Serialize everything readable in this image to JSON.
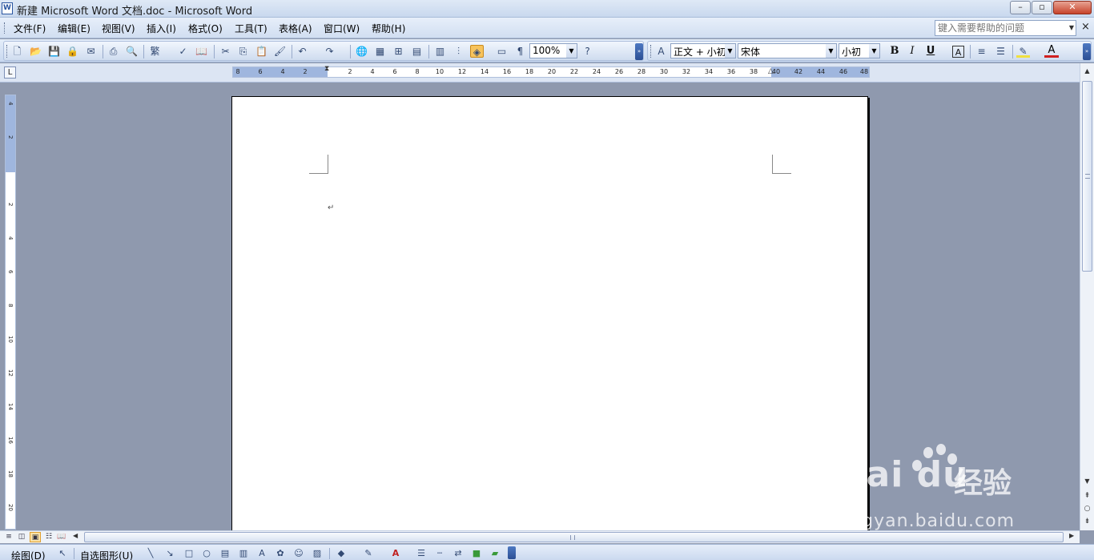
{
  "window": {
    "title": "新建 Microsoft Word 文档.doc - Microsoft Word",
    "app_icon": "W",
    "minimize_glyph": "–",
    "maximize_glyph": "▫",
    "close_glyph": "✕"
  },
  "menubar": {
    "items": [
      "文件(F)",
      "编辑(E)",
      "视图(V)",
      "插入(I)",
      "格式(O)",
      "工具(T)",
      "表格(A)",
      "窗口(W)",
      "帮助(H)"
    ],
    "help_placeholder": "键入需要帮助的问题",
    "close_doc_glyph": "×"
  },
  "standard_toolbar": {
    "zoom": "100%"
  },
  "format_toolbar": {
    "style": "正文 + 小初",
    "font": "宋体",
    "size": "小初",
    "bold": "B",
    "italic": "I",
    "underline": "U",
    "char_border": "A",
    "font_color": "A"
  },
  "ruler": {
    "tab_selector": "L",
    "left_ticks": [
      "8",
      "6",
      "4",
      "2"
    ],
    "right_ticks": [
      "2",
      "4",
      "6",
      "8",
      "10",
      "12",
      "14",
      "16",
      "18",
      "20",
      "22",
      "24",
      "26",
      "28",
      "30",
      "32",
      "34",
      "36",
      "38",
      "40",
      "42",
      "44",
      "46",
      "48"
    ],
    "vertical_ticks": [
      "4",
      "2",
      "2",
      "4",
      "6",
      "8",
      "10",
      "12",
      "14",
      "16",
      "18",
      "20"
    ]
  },
  "document": {
    "paragraph_mark": "↵"
  },
  "drawing_toolbar": {
    "draw_label": "绘图(D)",
    "autoshapes_label": "自选图形(U)"
  },
  "watermark": {
    "logo": "Bai  du",
    "brand_cn": "经验",
    "url": "jingyan.baidu.com"
  },
  "colors": {
    "workspace": "#8f99ae",
    "page": "#ffffff",
    "ruler_margin": "#9fb6de",
    "toolbar_accent": "#2c4f94"
  }
}
